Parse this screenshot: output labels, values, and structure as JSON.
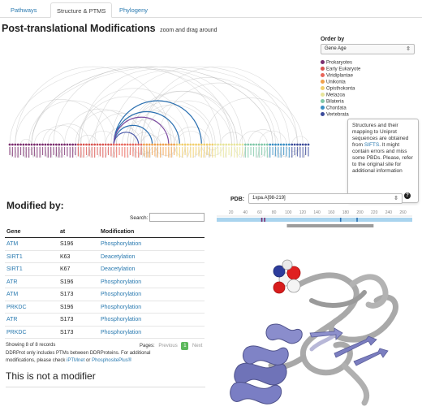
{
  "tabs": [
    {
      "label": "Pathways",
      "active": false
    },
    {
      "label": "Structure & PTMS",
      "active": true
    },
    {
      "label": "Phylogeny",
      "active": false
    }
  ],
  "page_title": "Post-translational Modifications",
  "page_subtitle": "zoom and drag around",
  "order_by": {
    "label": "Order by",
    "selected": "Gene Age"
  },
  "legend": [
    {
      "label": "Prokaryotes",
      "color": "#7b2c6e"
    },
    {
      "label": "Early Eukaryote",
      "color": "#d9534f"
    },
    {
      "label": "Viridiplantae",
      "color": "#e8665a"
    },
    {
      "label": "Unikonta",
      "color": "#f0a04b"
    },
    {
      "label": "Opisthokonta",
      "color": "#f2cf6c"
    },
    {
      "label": "Metazoa",
      "color": "#e8e59a"
    },
    {
      "label": "Bilateria",
      "color": "#7fc8a8"
    },
    {
      "label": "Chordata",
      "color": "#3a8fc4"
    },
    {
      "label": "Vertebrata",
      "color": "#3b4a9a"
    }
  ],
  "tooltip": {
    "pre": "Structures and their mapping to Uniprot sequences are obtained from ",
    "link": "SIFTS",
    "post": ". It might contain errors and miss some PBDs. Please, refer to the original site for additional information"
  },
  "help_icon": "question-icon",
  "modified_title": "Modified by:",
  "search": {
    "label": "Search:",
    "value": ""
  },
  "table": {
    "headers": [
      "Gene",
      "at",
      "Modification"
    ],
    "rows": [
      {
        "gene": "ATM",
        "at": "S196",
        "mod": "Phosphorylation"
      },
      {
        "gene": "SIRT1",
        "at": "K63",
        "mod": "Deacetylation"
      },
      {
        "gene": "SIRT1",
        "at": "K67",
        "mod": "Deacetylation"
      },
      {
        "gene": "ATR",
        "at": "S196",
        "mod": "Phosphorylation"
      },
      {
        "gene": "ATM",
        "at": "S173",
        "mod": "Phosphorylation"
      },
      {
        "gene": "PRKDC",
        "at": "S196",
        "mod": "Phosphorylation"
      },
      {
        "gene": "ATR",
        "at": "S173",
        "mod": "Phosphorylation"
      },
      {
        "gene": "PRKDC",
        "at": "S173",
        "mod": "Phosphorylation"
      }
    ]
  },
  "showing": "Showing 8 of 8 records",
  "pager": {
    "label": "Pages:",
    "prev": "Previous",
    "current": "1",
    "next": "Next"
  },
  "note": {
    "pre": "DDRProt only includes PTMs between DDRProteins. For additional modifications, please check ",
    "link1": "iPTMnet",
    "mid": " or ",
    "link2": "PhosphositePlus®"
  },
  "not_modifier": "This is not a modifier",
  "pdb": {
    "label": "PDB:",
    "selected": "1xpa.A[98-219]"
  },
  "sequence_ticks": [
    20,
    40,
    60,
    80,
    100,
    120,
    140,
    160,
    180,
    200,
    220,
    240,
    260
  ]
}
